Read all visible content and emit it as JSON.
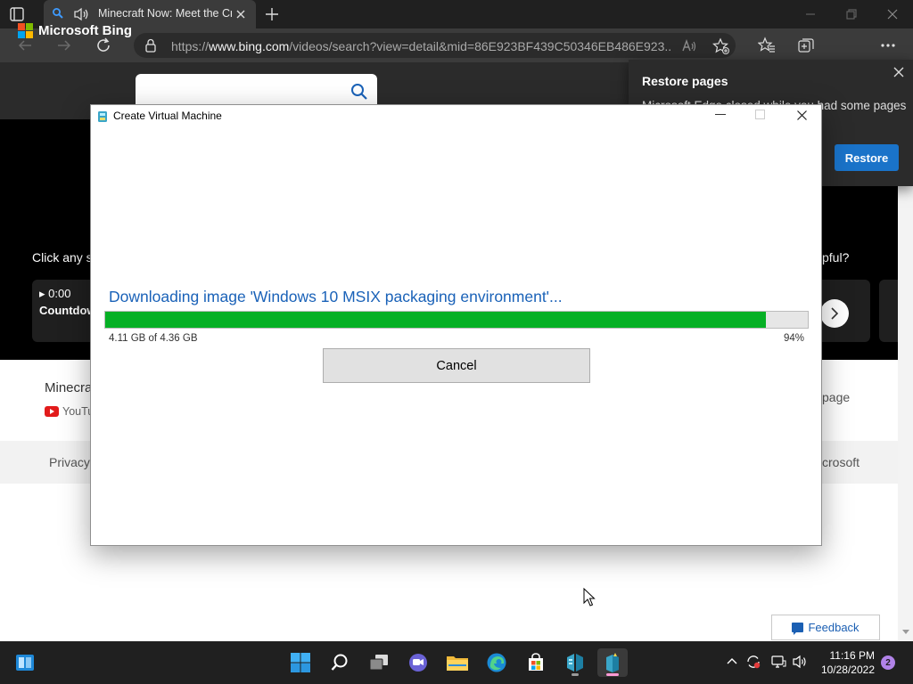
{
  "browser": {
    "tab_title": "Minecraft Now: Meet the Creators",
    "url_prefix": "https://",
    "url_host": "www.bing.com",
    "url_path": "/videos/search?view=detail&mid=86E923BF439C50346EB486E923...",
    "accent_color": "#1a73c9"
  },
  "bing": {
    "brand": "Microsoft Bing",
    "click_any_text": "Click any s",
    "helpful_text": "pful?",
    "card_time": "0:00",
    "card_title": "Countdow",
    "video_title": "Minecra",
    "source": "YouTu",
    "page_link": "page",
    "footer_privacy": "Privacy",
    "footer_ms": "crosoft"
  },
  "restore_popup": {
    "title": "Restore pages",
    "text": "Microsoft Edge closed while you had some pages",
    "button": "Restore"
  },
  "dialog": {
    "title": "Create Virtual Machine",
    "status": "Downloading image 'Windows 10 MSIX packaging environment'...",
    "progress_percent": 94,
    "size_text": "4.11 GB of 4.36 GB",
    "percent_text": "94%",
    "cancel_label": "Cancel"
  },
  "feedback": {
    "label": "Feedback"
  },
  "taskbar": {
    "apps": [
      "start-icon",
      "search-icon",
      "task-view-icon",
      "teams-chat-icon",
      "file-explorer-icon",
      "edge-icon",
      "store-icon",
      "hyper-v-manager-icon",
      "quick-create-icon"
    ],
    "time": "11:16 PM",
    "date": "10/28/2022",
    "notification_count": "2"
  }
}
